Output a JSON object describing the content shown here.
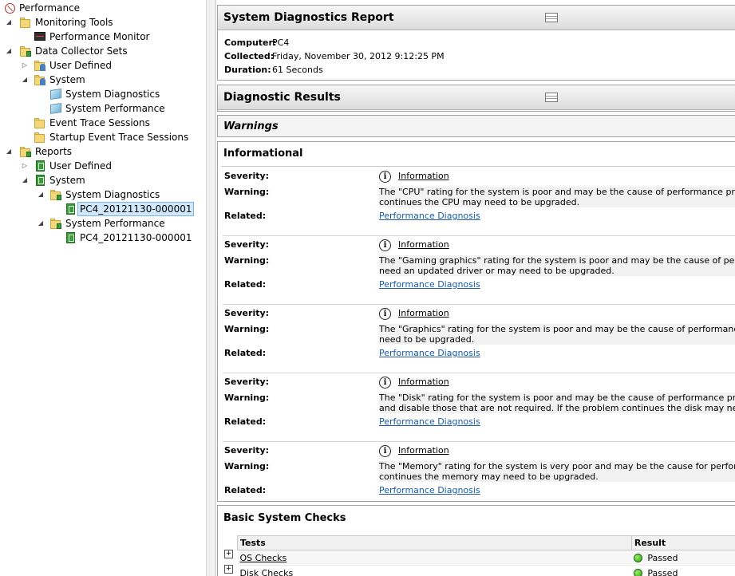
{
  "tree": {
    "root": "Performance",
    "monitoring_tools": "Monitoring Tools",
    "performance_monitor": "Performance Monitor",
    "data_collector_sets": "Data Collector Sets",
    "dcs_user_defined": "User Defined",
    "dcs_system": "System",
    "dcs_system_diagnostics": "System Diagnostics",
    "dcs_system_performance": "System Performance",
    "event_trace_sessions": "Event Trace Sessions",
    "startup_event_trace_sessions": "Startup Event Trace Sessions",
    "reports": "Reports",
    "rep_user_defined": "User Defined",
    "rep_system": "System",
    "rep_system_diagnostics": "System Diagnostics",
    "rep_diag_report": "PC4_20121130-000001",
    "rep_system_performance": "System Performance",
    "rep_perf_report": "PC4_20121130-000001"
  },
  "report": {
    "title": "System Diagnostics Report",
    "computer_label": "Computer:",
    "computer": "PC4",
    "collected_label": "Collected:",
    "collected": "Friday, November 30, 2012 9:12:25 PM",
    "duration_label": "Duration:",
    "duration": "61 Seconds",
    "diagnostic_results": "Diagnostic Results",
    "warnings": "Warnings",
    "informational": "Informational",
    "severity_label": "Severity:",
    "warning_label": "Warning:",
    "related_label": "Related:",
    "entries": [
      {
        "severity": "Information",
        "warning_line1": "The \"CPU\" rating for the system is poor and may be the cause of performance problems.",
        "warning_line2": "continues the CPU may need to be upgraded.",
        "related": "Performance Diagnosis"
      },
      {
        "severity": "Information",
        "warning_line1": "The \"Gaming graphics\" rating for the system is poor and may be the cause of performan",
        "warning_line2": "need an updated driver or may need to be upgraded.",
        "related": "Performance Diagnosis"
      },
      {
        "severity": "Information",
        "warning_line1": "The \"Graphics\" rating for the system is poor and may be the cause of performance prob",
        "warning_line2": "need to be upgraded.",
        "related": "Performance Diagnosis"
      },
      {
        "severity": "Information",
        "warning_line1": "The \"Disk\" rating for the system is poor and may be the cause of performance problems",
        "warning_line2": "and disable those that are not required. If the problem continues the disk may need to",
        "related": "Performance Diagnosis"
      },
      {
        "severity": "Information",
        "warning_line1": "The \"Memory\" rating for the system is very poor and may be the cause for performance i",
        "warning_line2": "continues the memory may need to be upgraded.",
        "related": "Performance Diagnosis"
      }
    ],
    "basic_checks": "Basic System Checks",
    "checks_headers": {
      "tests": "Tests",
      "result": "Result"
    },
    "checks": [
      {
        "test": "OS Checks",
        "result": "Passed"
      },
      {
        "test": "Disk Checks",
        "result": "Passed"
      }
    ]
  }
}
